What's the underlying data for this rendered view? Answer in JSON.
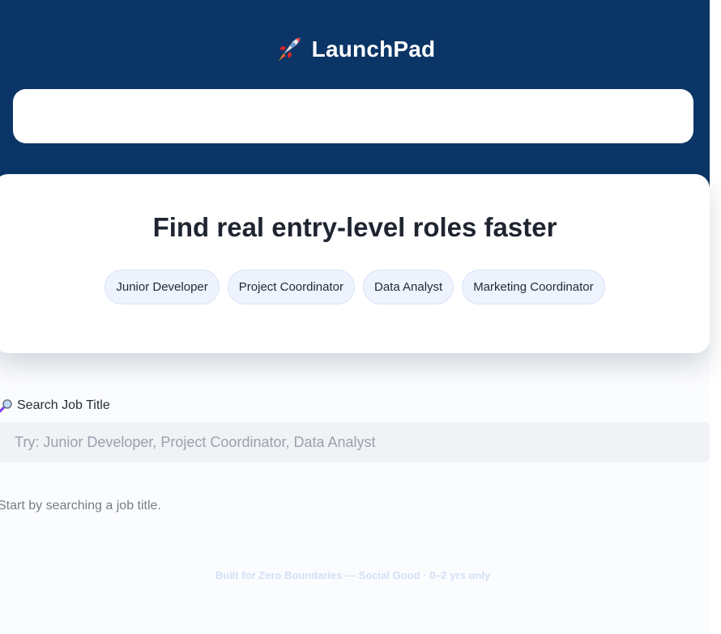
{
  "brand": {
    "title": "LaunchPad",
    "icon": "rocket-icon"
  },
  "hero": {
    "title": "Find real entry-level roles faster",
    "chips": [
      "Junior Developer",
      "Project Coordinator",
      "Data Analyst",
      "Marketing Coordinator"
    ]
  },
  "search": {
    "label": "Search Job Title",
    "label_icon": "magnifying-glass-icon",
    "placeholder": "Try: Junior Developer, Project Coordinator, Data Analyst",
    "value": ""
  },
  "hint": "Start by searching a job title.",
  "footer": "Built for Zero Boundaries — Social Good · 0–2 yrs only",
  "colors": {
    "header_bg": "#0b3566",
    "chip_bg": "#eef3fd",
    "chip_border": "#d9e3f8",
    "input_bg": "#f0f2f6",
    "footer_text": "#d3e0f7"
  }
}
